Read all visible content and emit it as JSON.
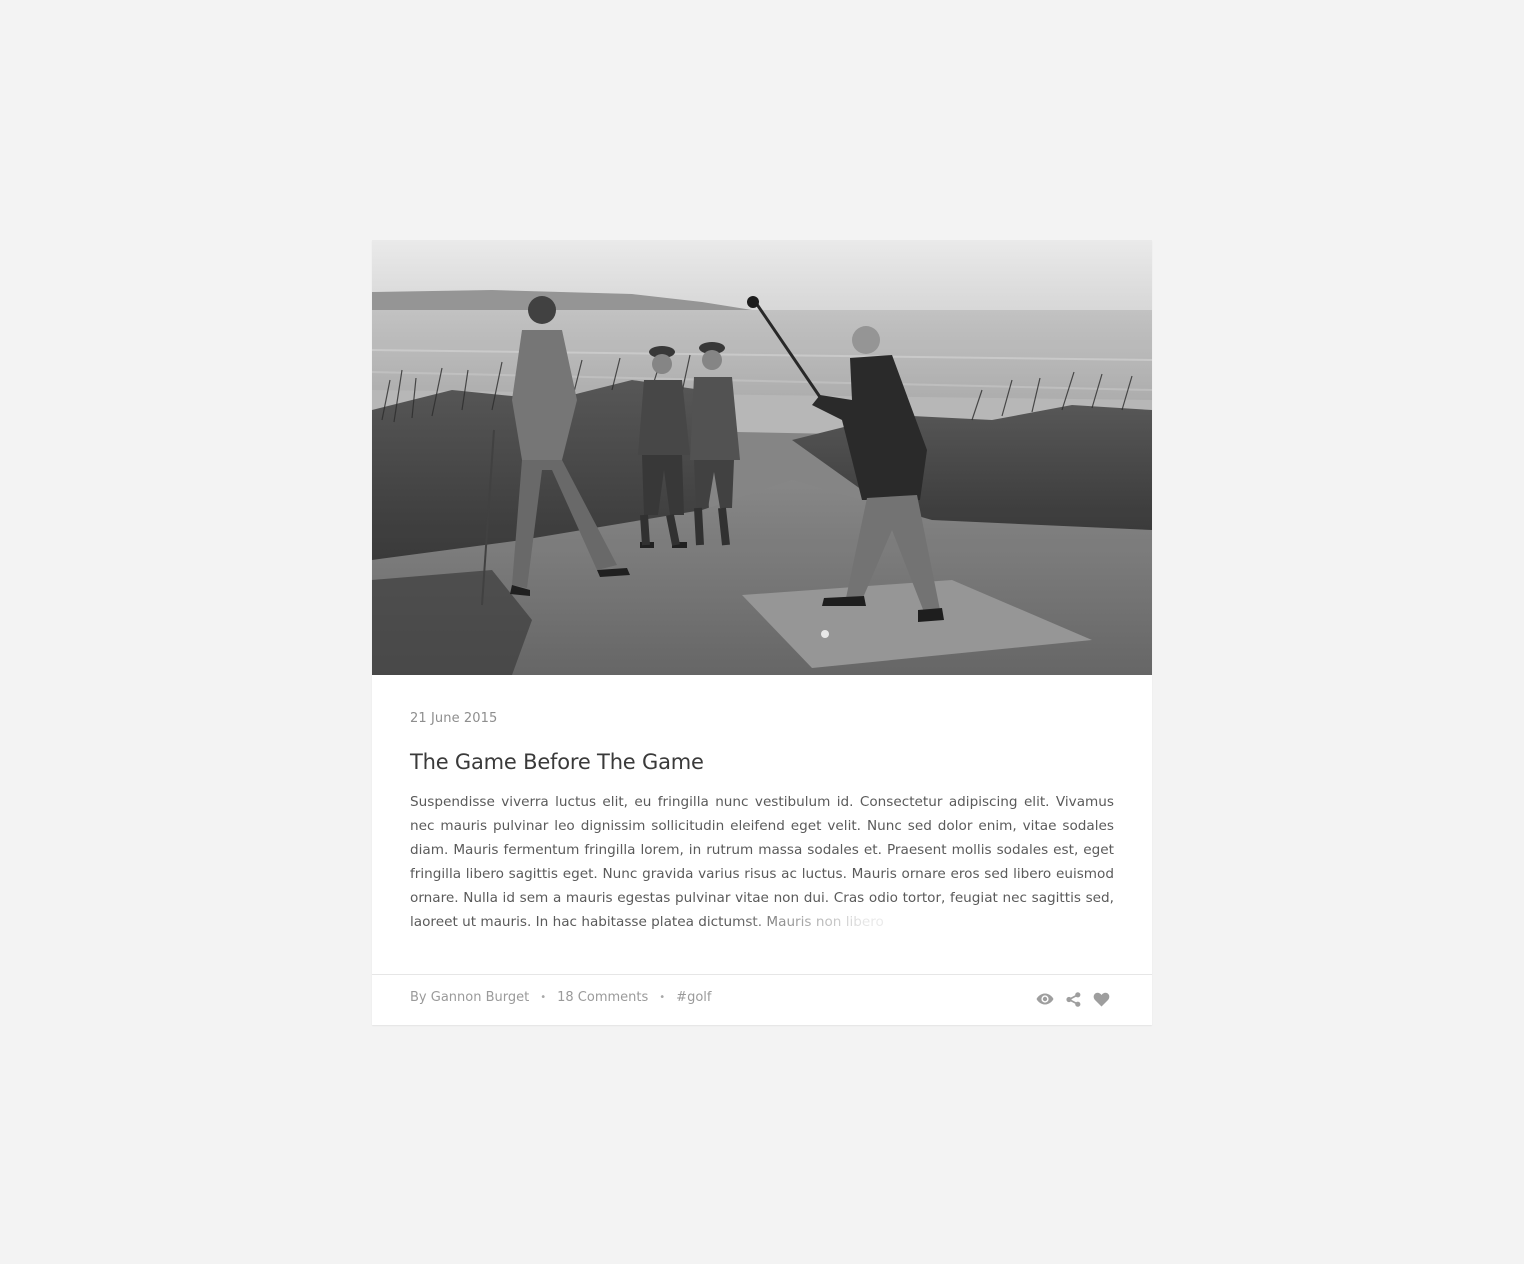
{
  "post": {
    "image_alt": "Vintage black and white photo of golfers on sand dunes by the sea",
    "date": "21 June 2015",
    "title": "The Game Before The Game",
    "excerpt": "Suspendisse viverra luctus elit, eu fringilla nunc vestibulum id. Consectetur adipiscing elit. Vivamus nec mauris pulvinar leo dignissim sollicitudin eleifend eget velit. Nunc sed dolor enim, vitae sodales diam. Mauris fermentum fringilla lorem, in rutrum massa sodales et. Praesent mollis sodales est, eget fringilla libero sagittis eget. Nunc gravida varius risus ac luctus. Mauris ornare eros sed libero euismod ornare. Nulla id sem a mauris egestas pulvinar vitae non dui. Cras odio tortor, feugiat nec sagittis sed, laoreet ut mauris. In hac habitasse platea dictumst. Mauris non libero",
    "author": "By Gannon Burget",
    "comments": "18 Comments",
    "tag": "#golf",
    "separator": "•"
  },
  "icons": {
    "view": "eye-icon",
    "share": "share-icon",
    "like": "heart-icon",
    "icon_color": "#9e9e9e"
  },
  "colors": {
    "page_background": "#f3f3f3",
    "card_background": "#ffffff",
    "title": "#3a3a3a",
    "meta": "#9a9a9a"
  }
}
